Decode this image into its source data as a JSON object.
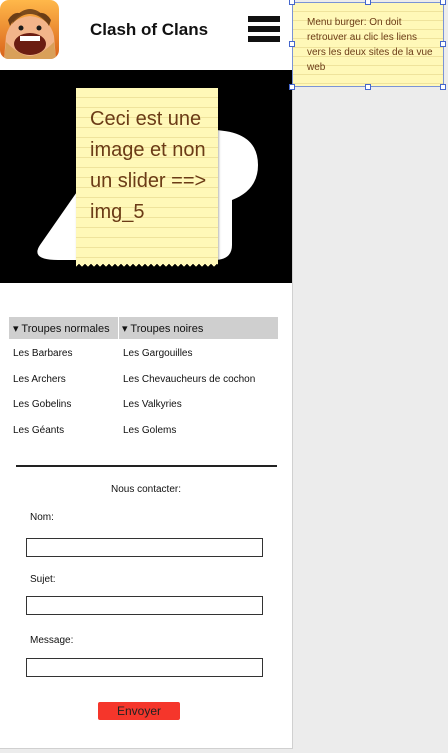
{
  "app": {
    "title": "Clash of Clans",
    "icon": "clash-of-clans-app-icon",
    "menu_icon": "hamburger-menu-icon"
  },
  "hero": {
    "note": "Ceci est une image et non un slider ==> img_5"
  },
  "troops": {
    "columns": [
      {
        "label": "▾ Troupes normales",
        "items": [
          "Les Barbares",
          "Les Archers",
          "Les Gobelins",
          "Les Géants"
        ]
      },
      {
        "label": "▾ Troupes noires",
        "items": [
          "Les Gargouilles",
          "Les Chevaucheurs de cochon",
          "Les Valkyries",
          "Les Golems"
        ]
      }
    ]
  },
  "contact": {
    "title": "Nous contacter:",
    "fields": [
      {
        "label": "Nom:",
        "value": ""
      },
      {
        "label": "Sujet:",
        "value": ""
      },
      {
        "label": "Message:",
        "value": ""
      }
    ],
    "submit_label": "Envoyer"
  },
  "annotation": {
    "text": "Menu burger: On doit retrouver au clic les liens vers les deux sites de la vue web"
  },
  "colors": {
    "submit_button": "#f5362b",
    "sticky_note": "#fff8b8",
    "note_text": "#6b3b16",
    "tabs_header": "#cfcfcf"
  }
}
